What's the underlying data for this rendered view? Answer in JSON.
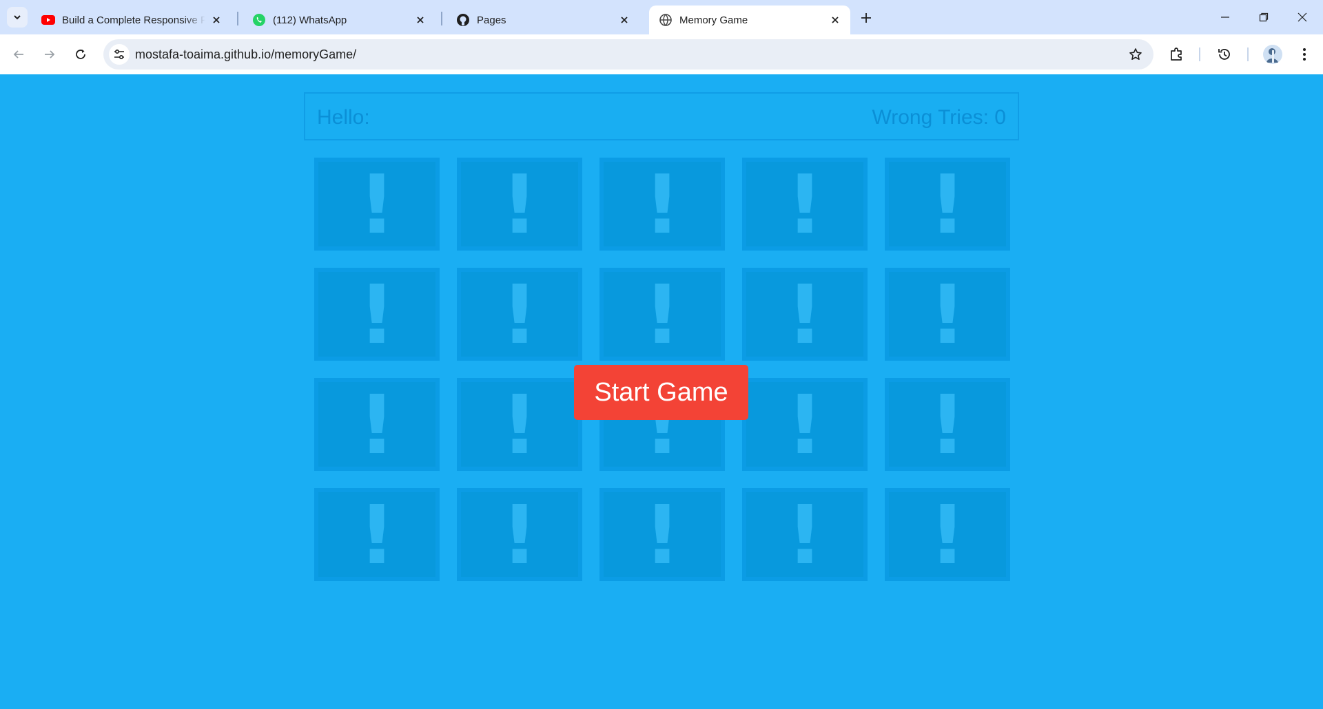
{
  "browser": {
    "tabs": [
      {
        "title": "Build a Complete Responsive Portfolio",
        "icon": "youtube-icon",
        "active": false
      },
      {
        "title": "(112) WhatsApp",
        "icon": "whatsapp-icon",
        "active": false
      },
      {
        "title": "Pages",
        "icon": "github-icon",
        "active": false
      },
      {
        "title": "Memory Game",
        "icon": "globe-icon",
        "active": true
      }
    ],
    "url": "mostafa-toaima.github.io/memoryGame/"
  },
  "game": {
    "hello_label": "Hello:",
    "wrong_tries_label": "Wrong Tries: 0",
    "card_symbol": "!",
    "rows": 4,
    "columns": 5,
    "start_button": "Start Game"
  },
  "colors": {
    "background": "#1aaef3",
    "card": "#0899dd",
    "start_button": "#f34336"
  }
}
